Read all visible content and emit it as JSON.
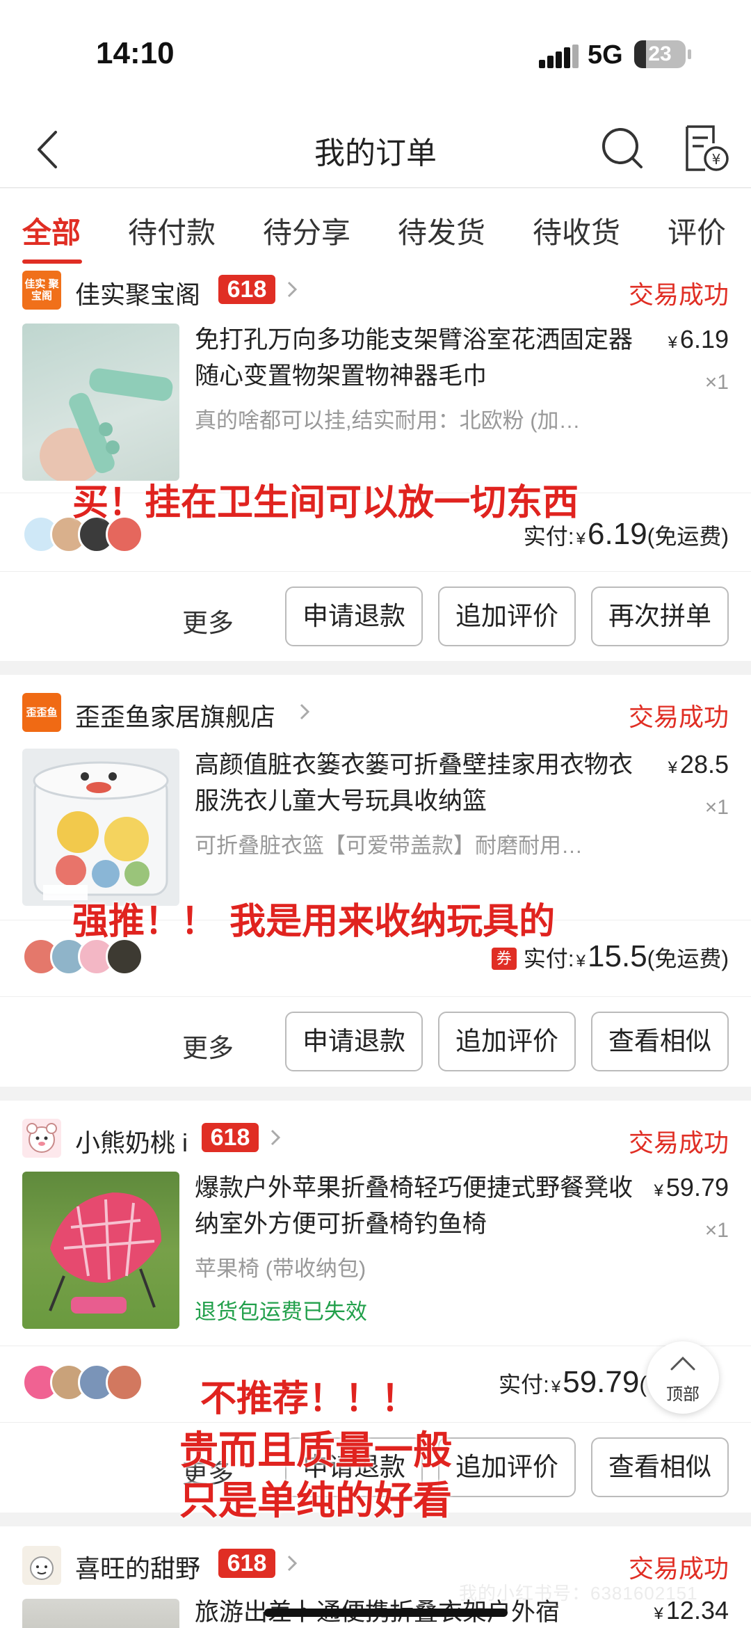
{
  "status_bar": {
    "time": "14:10",
    "network": "5G",
    "battery": "23",
    "battery_level": 0.23
  },
  "nav": {
    "title": "我的订单",
    "icons": [
      "back-icon",
      "search-icon",
      "bill-icon"
    ]
  },
  "tabs": [
    {
      "label": "全部",
      "active": true
    },
    {
      "label": "待付款"
    },
    {
      "label": "待分享"
    },
    {
      "label": "待发货"
    },
    {
      "label": "待收货"
    },
    {
      "label": "评价"
    }
  ],
  "orders": [
    {
      "shop_logo": "佳实 聚宝阁",
      "shop_name": "佳实聚宝阁",
      "badge": "618",
      "status": "交易成功",
      "title": "免打孔万向多功能支架臂浴室花洒固定器随心变置物架置物神器毛巾",
      "spec": "真的啥都可以挂,结实耐用：北欧粉 (加…",
      "price_symbol": "¥",
      "price": "6.19",
      "qty": "×1",
      "paid_label": "实付:",
      "paid_symbol": "¥",
      "paid_amount": "6.19",
      "shipping": "(免运费)",
      "more": "更多",
      "buttons": [
        "申请退款",
        "追加评价",
        "再次拼单"
      ],
      "overlay": "买！挂在卫生间可以放一切东西"
    },
    {
      "shop_logo": "歪歪鱼",
      "shop_name": "歪歪鱼家居旗舰店",
      "status": "交易成功",
      "title": "高颜值脏衣篓衣篓可折叠壁挂家用衣物衣服洗衣儿童大号玩具收纳篮",
      "spec": "可折叠脏衣篮【可爱带盖款】耐磨耐用…",
      "price_symbol": "¥",
      "price": "28.5",
      "qty": "×1",
      "coupon": "券",
      "paid_label": "实付:",
      "paid_symbol": "¥",
      "paid_amount": "15.5",
      "shipping": "(免运费)",
      "more": "更多",
      "buttons": [
        "申请退款",
        "追加评价",
        "查看相似"
      ],
      "overlay": "强推！！ 我是用来收纳玩具的"
    },
    {
      "shop_name": "小熊奶桃 i",
      "badge": "618",
      "status": "交易成功",
      "title": "爆款户外苹果折叠椅轻巧便捷式野餐凳收纳室外方便可折叠椅钓鱼椅",
      "spec": "苹果椅 (带收纳包)",
      "notice": "退货包运费已失效",
      "price_symbol": "¥",
      "price": "59.79",
      "qty": "×1",
      "paid_label": "实付:",
      "paid_symbol": "¥",
      "paid_amount": "59.79",
      "shipping": "(",
      "more": "更多",
      "buttons": [
        "申请退款",
        "追加评价",
        "查看相似"
      ],
      "overlay_lines": [
        "不推荐！！！",
        "贵而且质量一般",
        "只是单纯的好看"
      ]
    },
    {
      "shop_name": "喜旺的甜野",
      "badge": "618",
      "status": "交易成功",
      "title": "旅游出差卜通便携折叠衣架户外宿",
      "price_symbol": "¥",
      "price": "12.34"
    }
  ],
  "top_button": "顶部",
  "watermark": "我的小红书号：6381602151",
  "colors": {
    "accent": "#e02e24",
    "green": "#22a04b",
    "grey_text": "#999999"
  }
}
